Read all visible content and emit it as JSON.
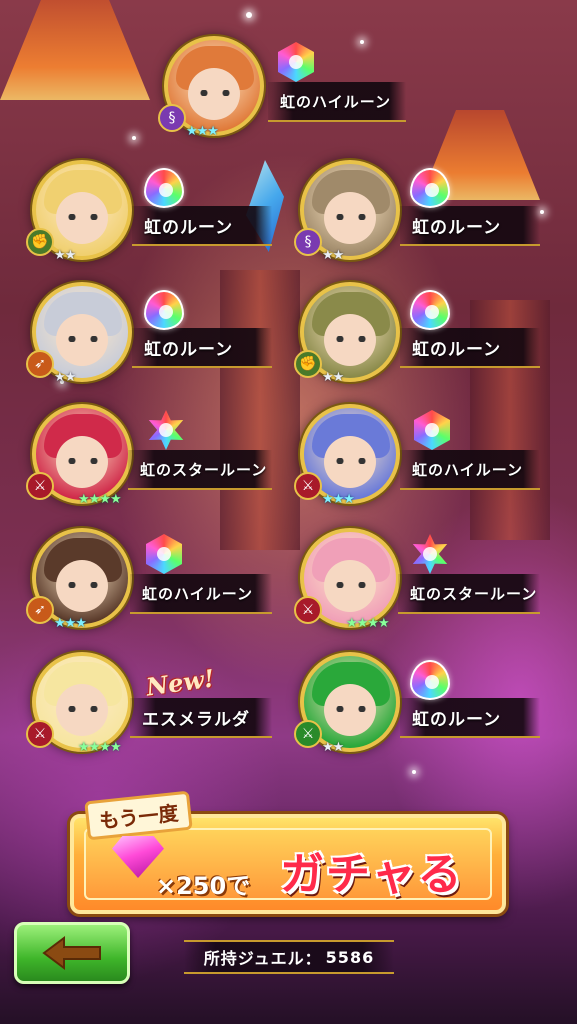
{
  "results": [
    {
      "item": "虹のハイルーン",
      "rune": "hex",
      "stars": "★★★",
      "star_count": 3,
      "hair": "#e07a3a",
      "cls": "staff-icon",
      "cls_color": "#7a3ab0"
    },
    {
      "item": "虹のルーン",
      "rune": "drop",
      "stars": "★★",
      "star_count": 2,
      "hair": "#f0d070",
      "cls": "fist-icon",
      "cls_color": "#4a7a2a"
    },
    {
      "item": "虹のルーン",
      "rune": "drop",
      "stars": "★★",
      "star_count": 2,
      "hair": "#a08a6a",
      "cls": "staff-icon",
      "cls_color": "#7a3ab0"
    },
    {
      "item": "虹のルーン",
      "rune": "drop",
      "stars": "★★",
      "star_count": 2,
      "hair": "#c8ccd8",
      "cls": "bow-icon",
      "cls_color": "#c85a1a"
    },
    {
      "item": "虹のルーン",
      "rune": "drop",
      "stars": "★★",
      "star_count": 2,
      "hair": "#8a8a4a",
      "cls": "fist-icon",
      "cls_color": "#4a7a2a"
    },
    {
      "item": "虹のスタールーン",
      "rune": "star",
      "stars": "★★★★",
      "star_count": 4,
      "hair": "#d02a4a",
      "cls": "sword-icon",
      "cls_color": "#a81a2a"
    },
    {
      "item": "虹のハイルーン",
      "rune": "hex",
      "stars": "★★★",
      "star_count": 3,
      "hair": "#6a7ad8",
      "cls": "sword-icon",
      "cls_color": "#a81a2a"
    },
    {
      "item": "虹のハイルーン",
      "rune": "hex",
      "stars": "★★★",
      "star_count": 3,
      "hair": "#5a3a2a",
      "cls": "bow-icon",
      "cls_color": "#c85a1a"
    },
    {
      "item": "虹のスタールーン",
      "rune": "star",
      "stars": "★★★★",
      "star_count": 4,
      "hair": "#f0a0b8",
      "cls": "sword-icon",
      "cls_color": "#a81a2a"
    },
    {
      "item": "エスメラルダ",
      "rune": "none",
      "stars": "★★★★",
      "star_count": 4,
      "hair": "#f6e6a0",
      "cls": "sword-icon",
      "cls_color": "#a81a2a",
      "is_new": true
    },
    {
      "item": "虹のルーン",
      "rune": "drop",
      "stars": "★★",
      "star_count": 2,
      "hair": "#2aa83a",
      "cls": "sword-icon",
      "cls_color": "#2a8a2a"
    }
  ],
  "new_label": "New!",
  "gacha_button": {
    "again_label": "もう一度",
    "cost": "×250で",
    "action_label": "ガチャる"
  },
  "jewels": {
    "label": "所持ジュエル：",
    "value": "5586"
  },
  "back_button_icon": "left-arrow-icon"
}
